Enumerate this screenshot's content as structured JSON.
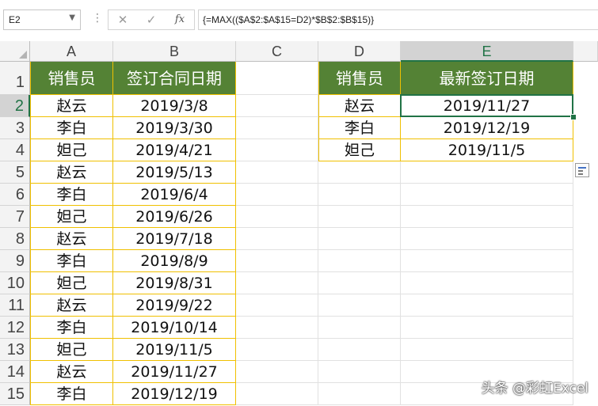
{
  "formula_bar": {
    "name_box": "E2",
    "formula": "{=MAX(($A$2:$A$15=D2)*$B$2:$B$15)}",
    "cancel_glyph": "✕",
    "enter_glyph": "✓",
    "fx_glyph": "fx"
  },
  "columns": [
    "A",
    "B",
    "C",
    "D",
    "E"
  ],
  "rows": [
    "1",
    "2",
    "3",
    "4",
    "5",
    "6",
    "7",
    "8",
    "9",
    "10",
    "11",
    "12",
    "13",
    "14",
    "15"
  ],
  "table1": {
    "header": [
      "销售员",
      "签订合同日期"
    ],
    "rows": [
      [
        "赵云",
        "2019/3/8"
      ],
      [
        "李白",
        "2019/3/30"
      ],
      [
        "妲己",
        "2019/4/21"
      ],
      [
        "赵云",
        "2019/5/13"
      ],
      [
        "李白",
        "2019/6/4"
      ],
      [
        "妲己",
        "2019/6/26"
      ],
      [
        "赵云",
        "2019/7/18"
      ],
      [
        "李白",
        "2019/8/9"
      ],
      [
        "妲己",
        "2019/8/31"
      ],
      [
        "赵云",
        "2019/9/22"
      ],
      [
        "李白",
        "2019/10/14"
      ],
      [
        "妲己",
        "2019/11/5"
      ],
      [
        "赵云",
        "2019/11/27"
      ],
      [
        "李白",
        "2019/12/19"
      ]
    ]
  },
  "table2": {
    "header": [
      "销售员",
      "最新签订日期"
    ],
    "rows": [
      [
        "赵云",
        "2019/11/27"
      ],
      [
        "李白",
        "2019/12/19"
      ],
      [
        "妲己",
        "2019/11/5"
      ]
    ]
  },
  "selected_cell": "E2",
  "colors": {
    "header_fill": "#548235",
    "border_yellow": "#f0c000",
    "selection": "#217346"
  },
  "watermark": "头条 @彩虹Excel"
}
